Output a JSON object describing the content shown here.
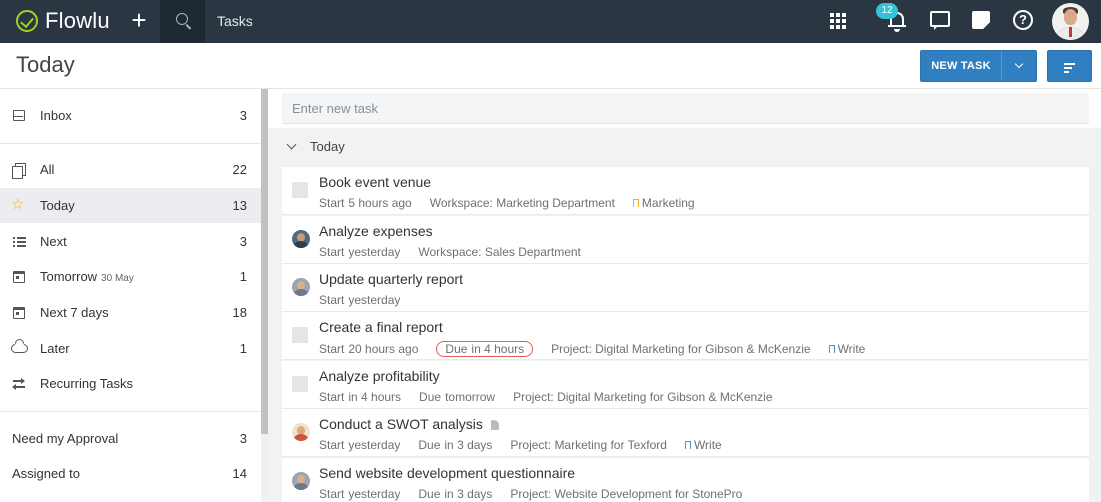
{
  "app": {
    "name": "Flowlu",
    "breadcrumb": "Tasks",
    "notifications_count": "12"
  },
  "header": {
    "title": "Today",
    "new_task_label": "NEW TASK"
  },
  "sidebar": {
    "items": [
      {
        "label": "Inbox",
        "count": "3",
        "icon": "inbox-icon"
      },
      {
        "label": "All",
        "count": "22",
        "icon": "copy-icon"
      },
      {
        "label": "Today",
        "count": "13",
        "icon": "star-icon",
        "active": true
      },
      {
        "label": "Next",
        "count": "3",
        "icon": "list-icon"
      },
      {
        "label": "Tomorrow",
        "sub": "30 May",
        "count": "1",
        "icon": "calendar-icon"
      },
      {
        "label": "Next 7 days",
        "count": "18",
        "icon": "calendar-week-icon"
      },
      {
        "label": "Later",
        "count": "1",
        "icon": "cloud-icon"
      },
      {
        "label": "Recurring Tasks",
        "count": "",
        "icon": "repeat-icon"
      }
    ],
    "filters": [
      {
        "label": "Need my Approval",
        "count": "3"
      },
      {
        "label": "Assigned to",
        "count": "14"
      }
    ]
  },
  "main": {
    "new_task_placeholder": "Enter new task",
    "section_label": "Today",
    "tasks": [
      {
        "title": "Book event venue",
        "start_k": "Start",
        "start_v": "5 hours ago",
        "context": "Workspace: Marketing Department",
        "tag": "Marketing",
        "tag_color": "#f2b21b",
        "marker": "checkbox"
      },
      {
        "title": "Analyze expenses",
        "start_k": "Start",
        "start_v": "yesterday",
        "context": "Workspace: Sales Department",
        "marker": "avatar"
      },
      {
        "title": "Update quarterly report",
        "start_k": "Start",
        "start_v": "yesterday",
        "marker": "avatar"
      },
      {
        "title": "Create a final report",
        "start_k": "Start",
        "start_v": "20 hours ago",
        "due_k": "Due",
        "due_v": "in 4 hours",
        "due_overdue": true,
        "context": "Project: Digital Marketing for Gibson & McKenzie",
        "tag": "Write",
        "tag_color": "#4a90d9",
        "marker": "checkbox"
      },
      {
        "title": "Analyze profitability",
        "start_k": "Start",
        "start_v": "in 4 hours",
        "due_k": "Due",
        "due_v": "tomorrow",
        "context": "Project: Digital Marketing for Gibson & McKenzie",
        "marker": "checkbox"
      },
      {
        "title": "Conduct a SWOT analysis",
        "start_k": "Start",
        "start_v": "yesterday",
        "due_k": "Due",
        "due_v": "in 3 days",
        "context": "Project: Marketing for Texford",
        "tag": "Write",
        "tag_color": "#4a90d9",
        "marker": "avatar",
        "has_attachment": true
      },
      {
        "title": "Send website development questionnaire",
        "start_k": "Start",
        "start_v": "yesterday",
        "due_k": "Due",
        "due_v": "in 3 days",
        "context": "Project: Website Development for StonePro",
        "marker": "avatar"
      }
    ]
  },
  "colors": {
    "topbar": "#2b3643",
    "accent": "#2f7fc1",
    "logo": "#a2d22a",
    "badge": "#36c2d8",
    "overdue": "#e05d5d"
  }
}
